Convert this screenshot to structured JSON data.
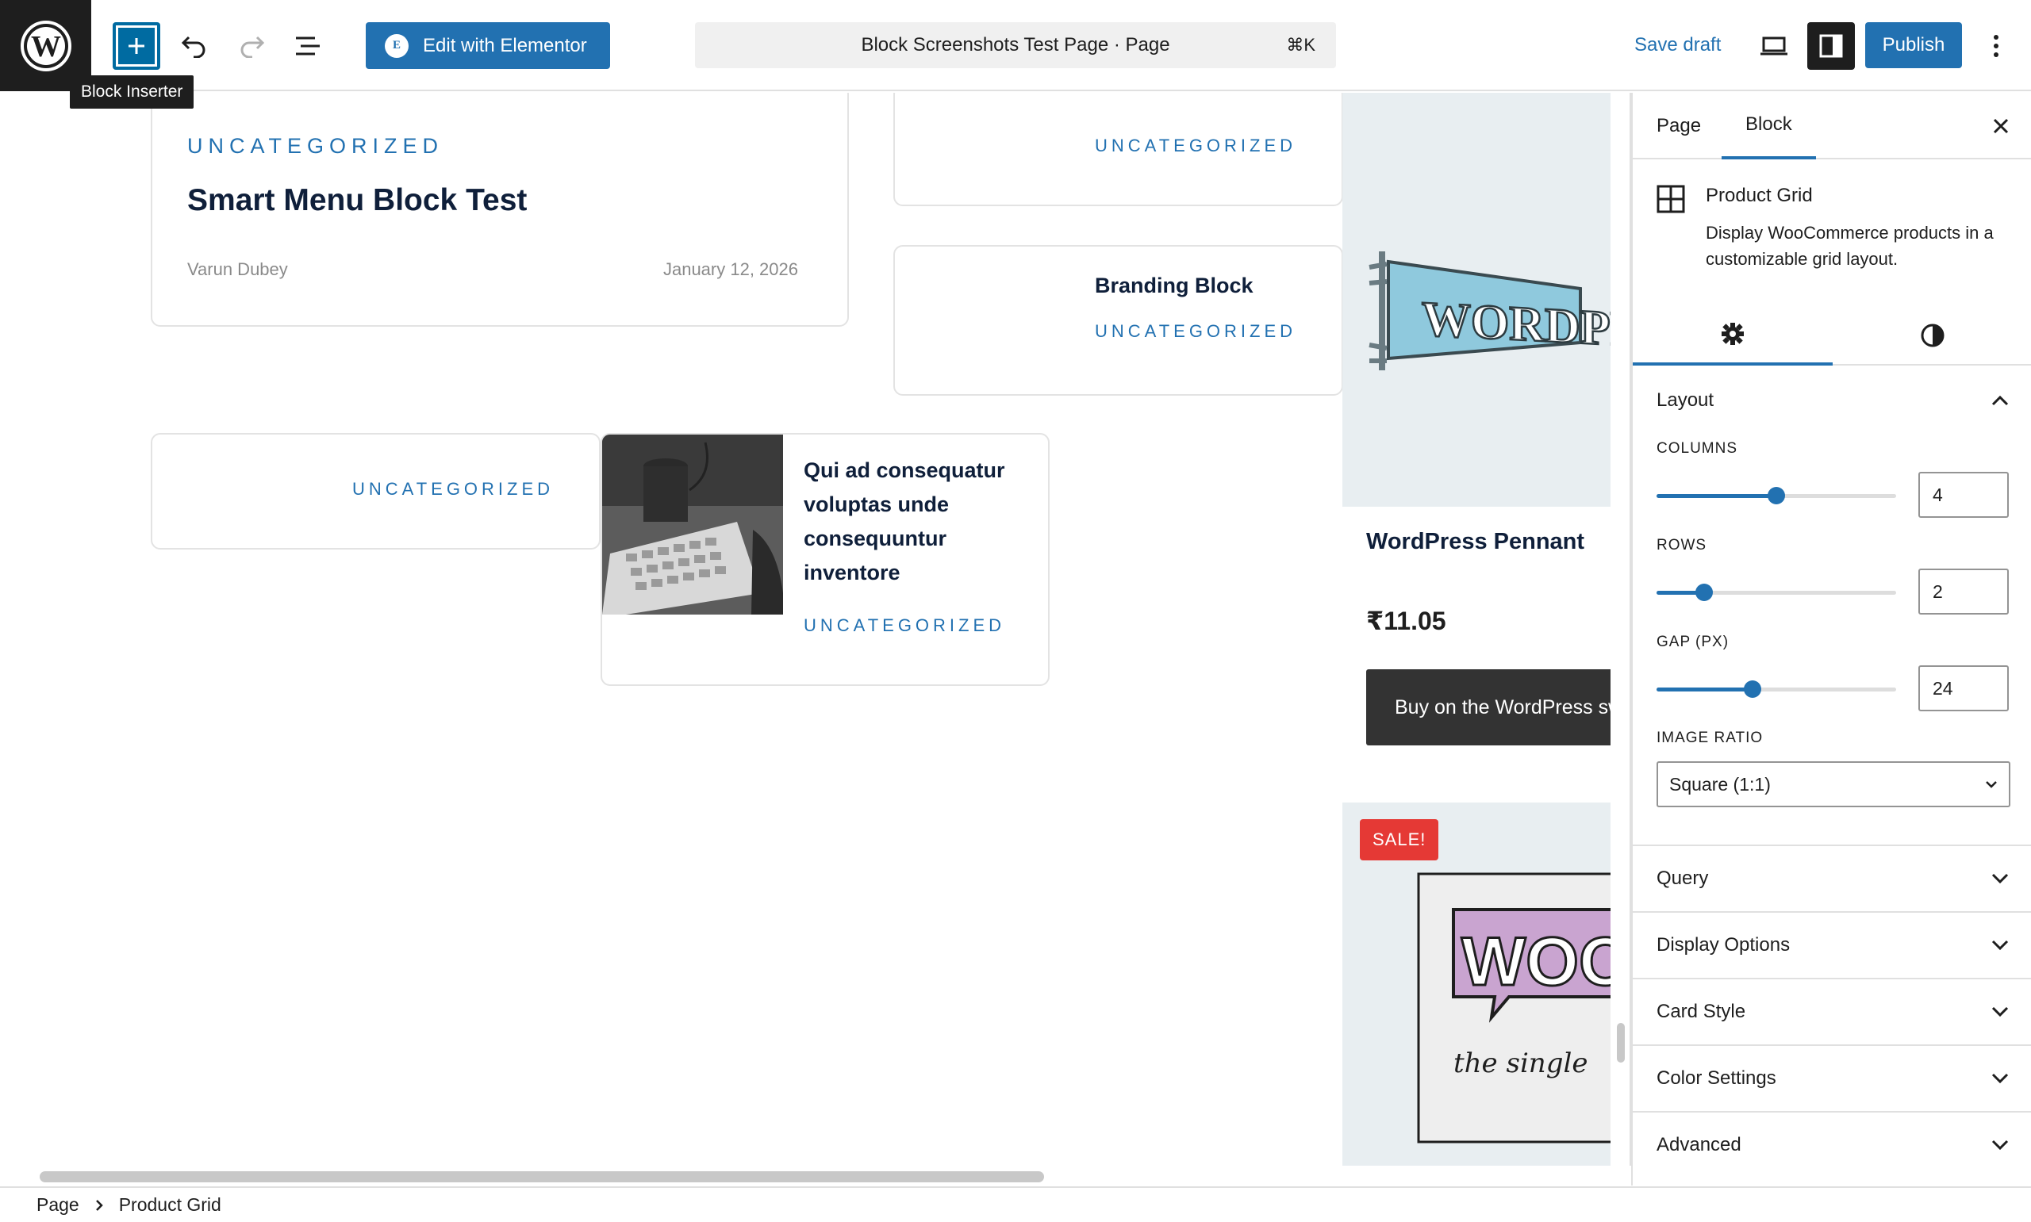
{
  "toolbar": {
    "inserter_tooltip": "Block Inserter",
    "elementor_label": "Edit with Elementor",
    "doc_title": "Block Screenshots Test Page · Page",
    "shortcut": "⌘K",
    "save_draft": "Save draft",
    "publish": "Publish"
  },
  "canvas": {
    "post1": {
      "category": "UNCATEGORIZED",
      "title": "Smart Menu Block Test",
      "author": "Varun Dubey",
      "date": "January 12, 2026"
    },
    "post2": {
      "category": "UNCATEGORIZED"
    },
    "post3": {
      "title": "Branding Block",
      "category": "UNCATEGORIZED"
    },
    "post4": {
      "category": "UNCATEGORIZED"
    },
    "post5": {
      "title_lines": [
        "Qui ad consequatur",
        "voluptas unde",
        "consequuntur",
        "inventore"
      ],
      "category": "UNCATEGORIZED"
    },
    "product1": {
      "name": "WordPress Pennant",
      "price": "₹11.05",
      "button": "Buy on the WordPress swag store!",
      "pennant_text": "WORDPRESS"
    },
    "product2": {
      "badge": "SALE!",
      "image_text": "WOO",
      "image_subtext": "the single"
    }
  },
  "sidebar": {
    "tabs": [
      "Page",
      "Block"
    ],
    "active_tab": "Block",
    "block": {
      "name": "Product Grid",
      "description": "Display WooCommerce products in a customizable grid layout."
    },
    "layout": {
      "title": "Layout",
      "columns": {
        "label": "COLUMNS",
        "value": "4",
        "min": 1,
        "max": 8,
        "fraction": 0.5
      },
      "rows": {
        "label": "ROWS",
        "value": "2",
        "min": 1,
        "max": 10,
        "fraction": 0.2
      },
      "gap": {
        "label": "GAP (PX)",
        "value": "24",
        "min": 0,
        "max": 60,
        "fraction": 0.4
      },
      "image_ratio": {
        "label": "IMAGE RATIO",
        "value": "Square (1:1)"
      }
    },
    "panels": [
      "Query",
      "Display Options",
      "Card Style",
      "Color Settings",
      "Advanced"
    ]
  },
  "breadcrumb": [
    "Page",
    "Product Grid"
  ],
  "colors": {
    "accent": "#2271b1",
    "dark": "#1e1e1e",
    "sale": "#e53935"
  }
}
